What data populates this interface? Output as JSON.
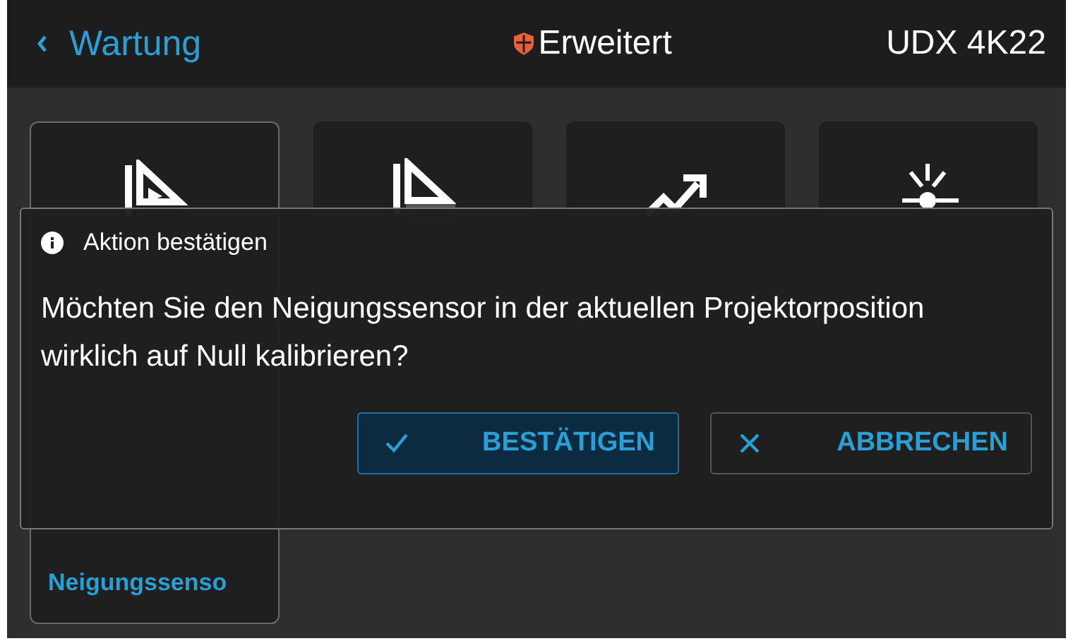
{
  "header": {
    "back": "Wartung",
    "title": "Erweitert",
    "device": "UDX 4K22"
  },
  "tiles": [
    {
      "label": "Neigungssenso",
      "selected": true
    },
    {
      "selected": false
    },
    {
      "selected": false
    },
    {
      "selected": false
    }
  ],
  "dialog": {
    "title": "Aktion bestätigen",
    "message": "Möchten Sie den Neigungssensor in der aktuellen Projektorposition wirklich auf Null kalibrieren?",
    "buttons": [
      {
        "label": "BESTÄTIGEN",
        "kind": "confirm",
        "selected": true
      },
      {
        "label": "ABBRECHEN",
        "kind": "cancel",
        "selected": false
      }
    ]
  }
}
